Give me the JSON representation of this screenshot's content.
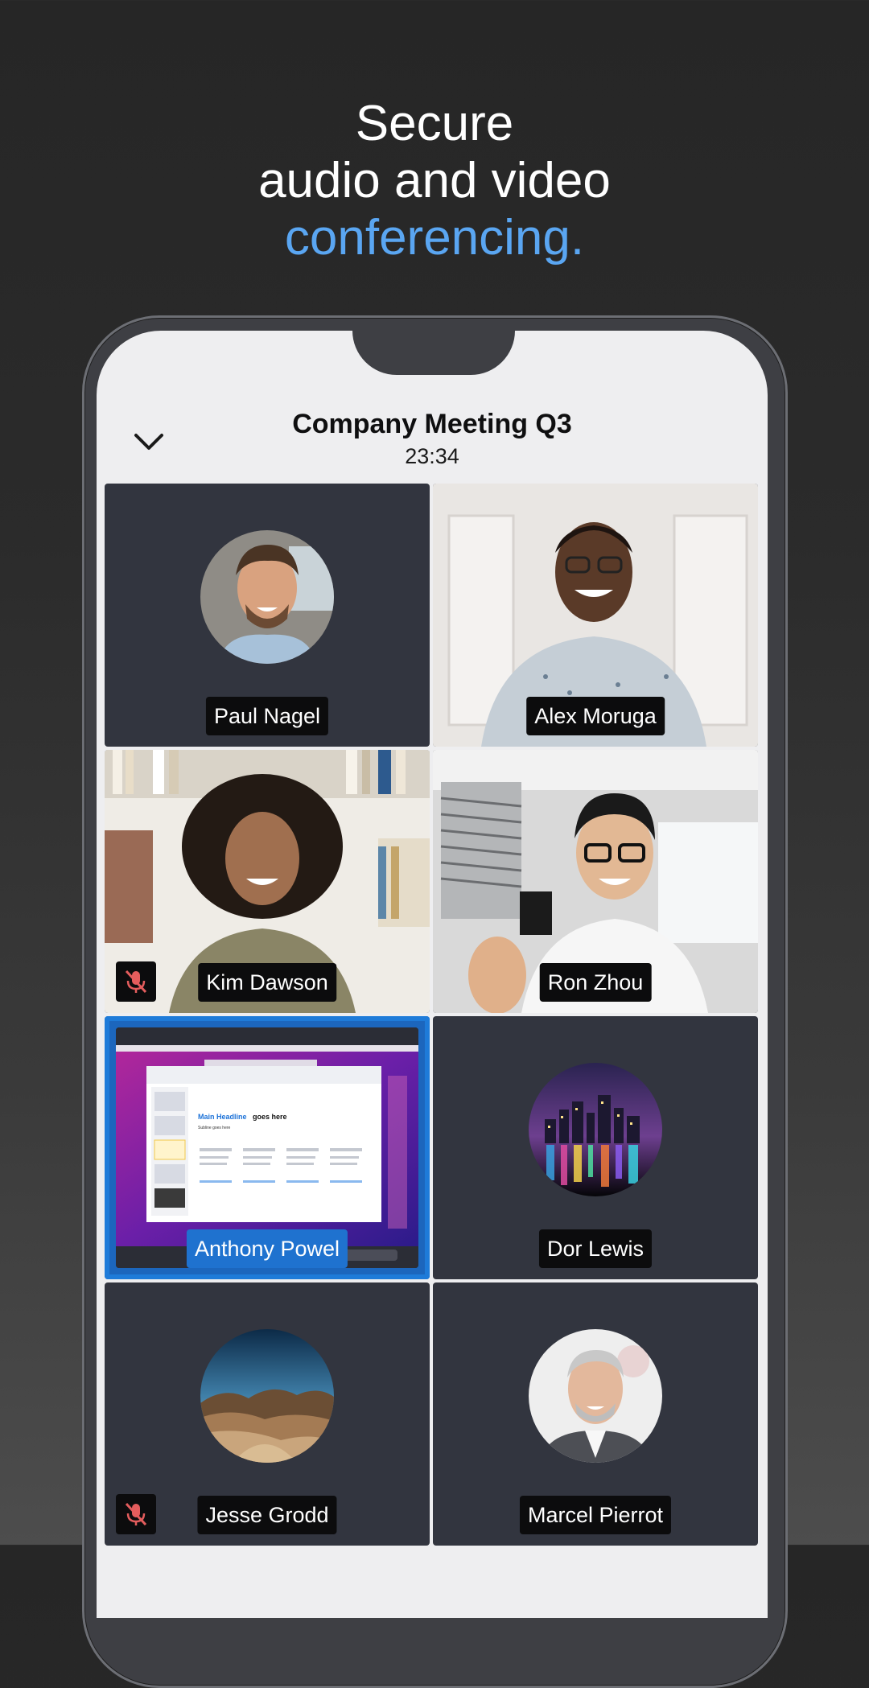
{
  "promo": {
    "line1": "Secure",
    "line2": "audio and video",
    "line3": "conferencing."
  },
  "colors": {
    "accent": "#5aa6f2",
    "active_border": "#1e7bd9",
    "tile_bg": "#32353f"
  },
  "meeting": {
    "title": "Company Meeting Q3",
    "elapsed": "23:34",
    "collapse_icon": "chevron-down-icon"
  },
  "participants": [
    {
      "name": "Paul Nagel",
      "view": "avatar",
      "muted": false
    },
    {
      "name": "Alex Moruga",
      "view": "video",
      "muted": false
    },
    {
      "name": "Kim Dawson",
      "view": "video",
      "muted": true
    },
    {
      "name": "Ron Zhou",
      "view": "video",
      "muted": false
    },
    {
      "name": "Anthony Powel",
      "view": "screen-share",
      "muted": false,
      "active": true
    },
    {
      "name": "Dor Lewis",
      "view": "avatar",
      "muted": false
    },
    {
      "name": "Jesse Grodd",
      "view": "avatar",
      "muted": true
    },
    {
      "name": "Marcel Pierrot",
      "view": "avatar",
      "muted": false
    }
  ],
  "shared_screen": {
    "headline_part1": "Main Headline",
    "headline_part2": "goes here",
    "subline": "Subline goes here"
  }
}
